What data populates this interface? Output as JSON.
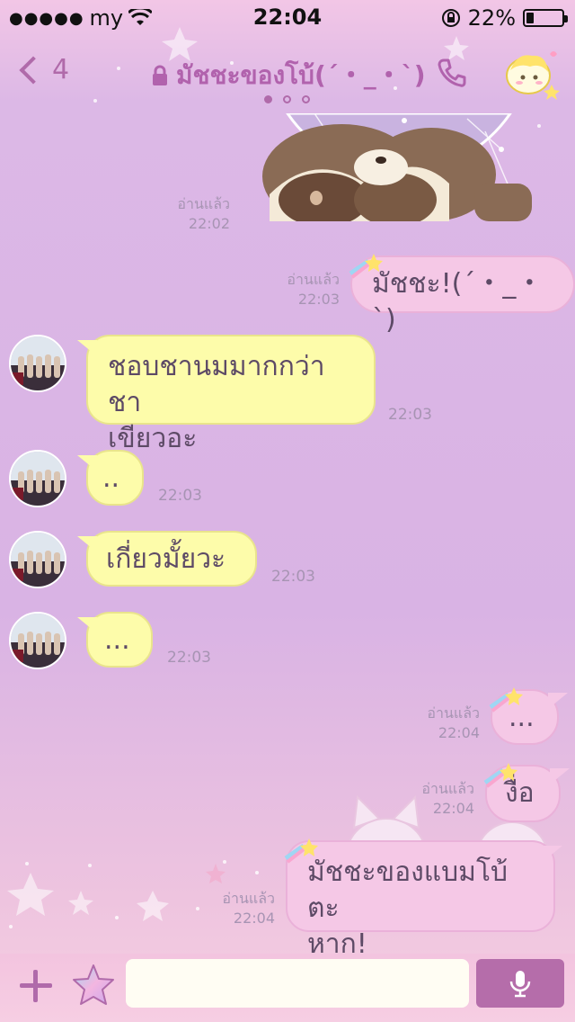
{
  "status_bar": {
    "carrier": "my",
    "time": "22:04",
    "battery_percent": "22%",
    "battery_level": 0.22
  },
  "header": {
    "back_count": "4",
    "title": "มัชชะของโบ้(´・_・`)",
    "icons": [
      "back-chevron-icon",
      "lock-icon",
      "phone-icon"
    ],
    "accent_color": "#b06aaa"
  },
  "messages": {
    "m1": {
      "read": "อ่านแล้ว",
      "time": "22:02"
    },
    "m2": {
      "read": "อ่านแล้ว",
      "time": "22:03",
      "text": "มัชชะ!(´・_・`)"
    },
    "m3": {
      "time": "22:03",
      "line1": "ชอบชานมมากกว่าชา",
      "line2": "เขียวอะ"
    },
    "m4": {
      "time": "22:03",
      "text": ".."
    },
    "m5": {
      "time": "22:03",
      "text": "เกี่ยวมั้ยวะ"
    },
    "m6": {
      "time": "22:03",
      "text": "..."
    },
    "m7": {
      "read": "อ่านแล้ว",
      "time": "22:04",
      "text": "..."
    },
    "m8": {
      "read": "อ่านแล้ว",
      "time": "22:04",
      "text": "งื่อ"
    },
    "m9": {
      "read": "อ่านแล้ว",
      "time": "22:04",
      "line1": "มัชชะของแบมโบ้ตะ",
      "line2": "หาก!"
    }
  },
  "input": {
    "placeholder": ""
  }
}
